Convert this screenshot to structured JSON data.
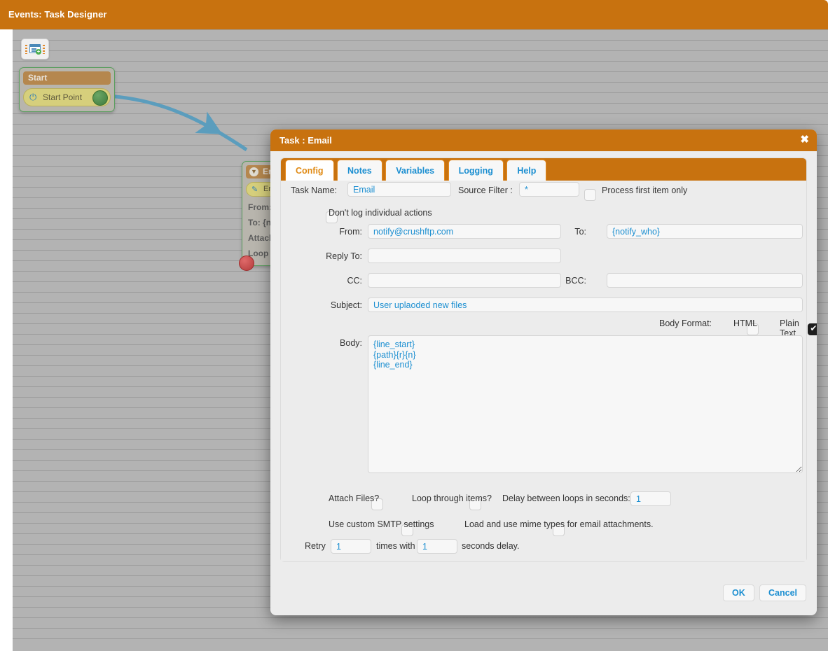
{
  "app": {
    "header_title": "Events: Task Designer"
  },
  "canvas": {
    "toolbar": {
      "add_task_icon": "add-document-icon"
    },
    "nodes": [
      {
        "id": "start",
        "title": "Start",
        "item_label": "Start Point",
        "item_icon": "power-icon",
        "port_out": "green"
      },
      {
        "id": "email",
        "title": "Email",
        "title_icon": "collapse-icon",
        "item_label": "Email",
        "item_icon": "pencil-icon",
        "props": [
          "From: {notify_from}",
          "To:  {notify_who}",
          "Attach Files?: false",
          "Loop through items?: false"
        ],
        "port_in": "red"
      }
    ]
  },
  "dialog": {
    "title": "Task : Email",
    "close_label": "✖",
    "tabs": [
      {
        "label": "Config",
        "active": true
      },
      {
        "label": "Notes",
        "active": false
      },
      {
        "label": "Variables",
        "active": false
      },
      {
        "label": "Logging",
        "active": false
      },
      {
        "label": "Help",
        "active": false
      }
    ],
    "fields": {
      "task_name_label": "Task Name:",
      "task_name_value": "Email",
      "source_filter_label": "Source Filter :",
      "source_filter_value": "*",
      "process_first_item_label": "Process first item only",
      "process_first_item_checked": false,
      "dont_log_label": "Don't log individual actions",
      "dont_log_checked": false,
      "from_label": "From:",
      "from_value": "notify@crushftp.com",
      "to_label": "To:",
      "to_value": "{notify_who}",
      "reply_to_label": "Reply To:",
      "reply_to_value": "",
      "cc_label": "CC:",
      "cc_value": "",
      "bcc_label": "BCC:",
      "bcc_value": "",
      "subject_label": "Subject:",
      "subject_value": "User uplaoded new files",
      "body_format_label": "Body Format:",
      "html_label": "HTML",
      "html_checked": false,
      "plain_text_label": "Plain Text",
      "plain_text_checked": true,
      "body_label": "Body:",
      "body_value": "{line_start}\n{path}{r}{n}\n{line_end}",
      "attach_files_label": "Attach Files?",
      "attach_files_checked": false,
      "loop_items_label": "Loop through items?",
      "loop_items_checked": false,
      "delay_loops_label": "Delay between loops in seconds:",
      "delay_loops_value": "1",
      "custom_smtp_label": "Use custom SMTP settings",
      "custom_smtp_checked": false,
      "mime_types_label": "Load and use mime types for email attachments.",
      "mime_types_checked": false,
      "retry_prefix": "Retry",
      "retry_times_value": "1",
      "retry_mid": "times with",
      "retry_delay_value": "1",
      "retry_suffix": "seconds delay."
    },
    "buttons": {
      "ok_label": "OK",
      "cancel_label": "Cancel"
    }
  },
  "colors": {
    "brand_orange": "#c8720f",
    "link_blue": "#1c8fd1",
    "canvas_gray": "#b3b3b3",
    "connector_blue": "#5b9dbd"
  }
}
